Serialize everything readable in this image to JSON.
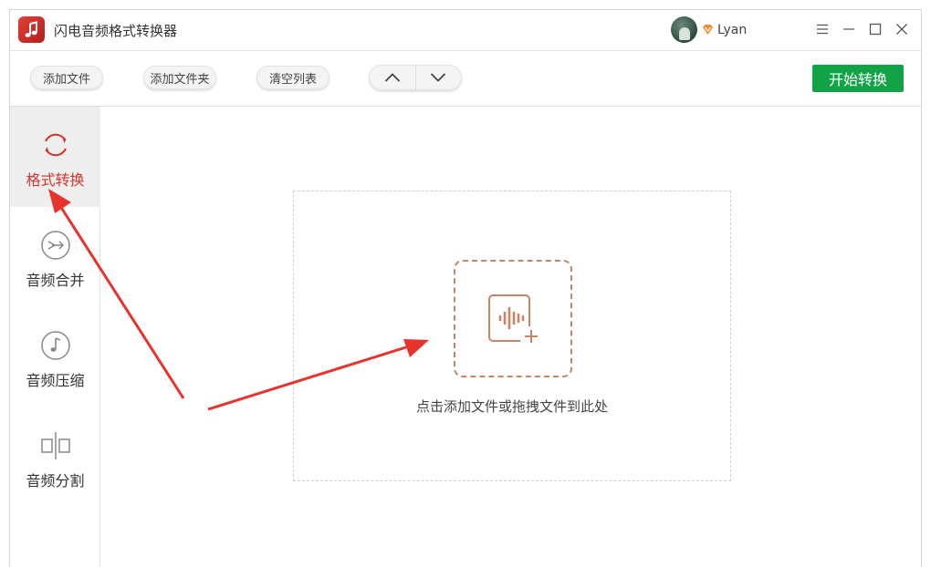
{
  "app": {
    "title": "闪电音频格式转换器"
  },
  "user": {
    "name": "Lyan"
  },
  "toolbar": {
    "add_file": "添加文件",
    "add_folder": "添加文件夹",
    "clear_list": "清空列表",
    "start": "开始转换"
  },
  "sidebar": {
    "items": [
      {
        "label": "格式转换",
        "icon": "refresh-icon",
        "active": true
      },
      {
        "label": "音频合并",
        "icon": "merge-icon",
        "active": false
      },
      {
        "label": "音频压缩",
        "icon": "music-note-icon",
        "active": false
      },
      {
        "label": "音频分割",
        "icon": "split-icon",
        "active": false
      }
    ]
  },
  "dropzone": {
    "hint": "点击添加文件或拖拽文件到此处"
  },
  "colors": {
    "accent": "#d6332d",
    "start_button": "#12a346",
    "dropzone_border": "#c9856a",
    "annotation": "#e8322b"
  }
}
